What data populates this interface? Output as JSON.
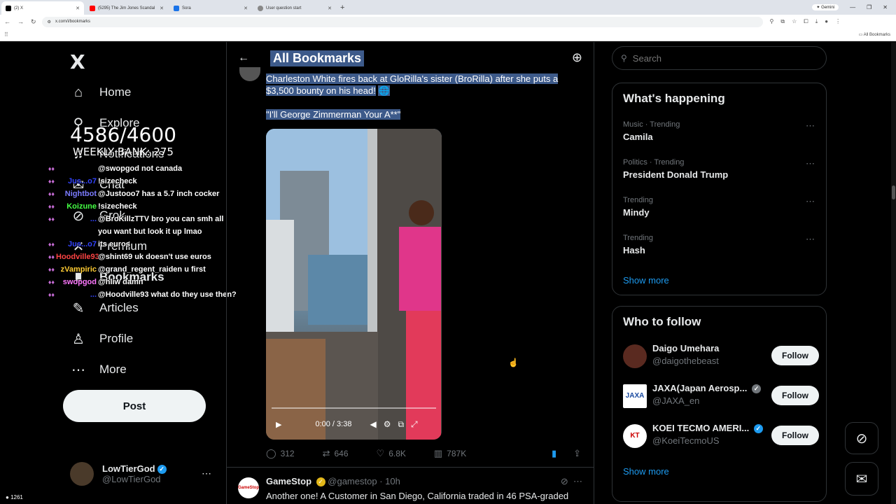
{
  "browser": {
    "tabs": [
      {
        "label": "(2) X",
        "color": "#000000"
      },
      {
        "label": "(5295) The Jim Jones Scandal",
        "color": "#ff0000"
      },
      {
        "label": "Sora",
        "color": "#1a73e8"
      },
      {
        "label": "User question start",
        "color": "#777777"
      }
    ],
    "gemini": "Gemini",
    "url": "x.com/i/bookmarks",
    "all_bookmarks": "All Bookmarks"
  },
  "sidebar": {
    "logo": "X",
    "items": [
      {
        "label": "Home",
        "icon": "home-icon"
      },
      {
        "label": "Explore",
        "icon": "search-icon"
      },
      {
        "label": "Notifications",
        "icon": "bell-icon"
      },
      {
        "label": "Chat",
        "icon": "mail-icon"
      },
      {
        "label": "Grok",
        "icon": "grok-icon"
      },
      {
        "label": "Premium",
        "icon": "x-icon"
      },
      {
        "label": "Bookmarks",
        "icon": "bookmark-icon"
      },
      {
        "label": "Articles",
        "icon": "article-icon"
      },
      {
        "label": "Profile",
        "icon": "person-icon"
      },
      {
        "label": "More",
        "icon": "more-icon"
      }
    ],
    "post": "Post",
    "user": {
      "name": "LowTierGod",
      "handle": "@LowTierGod"
    }
  },
  "overlay": {
    "count": "4586/4600",
    "weekly": "WEEKLY BANK: 275",
    "chat": [
      {
        "user": "",
        "msg": "@swopgod not canada",
        "color": "#c86dd7"
      },
      {
        "user": "Jus...o7",
        "msg": "!sizecheck",
        "color": "#3344ff"
      },
      {
        "user": "Nightbot",
        "msg": "@Justooo7 has a 5.7 inch cocker",
        "color": "#7c7cff"
      },
      {
        "user": "Koizune",
        "msg": "!sizecheck",
        "color": "#44ff44"
      },
      {
        "user": "...",
        "msg": "@BroKillzTTV bro you can smh all you want but look it up lmao",
        "color": "#3344ff"
      },
      {
        "user": "Jus...o7",
        "msg": "its euros",
        "color": "#3344ff"
      },
      {
        "user": "Hoodville93",
        "msg": "@shint69 uk doesn't use euros",
        "color": "#ff4444"
      },
      {
        "user": "zVampiric",
        "msg": "@grand_regent_raiden u first",
        "color": "#ffcc33"
      },
      {
        "user": "swopgod",
        "msg": "@hliw damn",
        "color": "#ff77ff"
      },
      {
        "user": "...",
        "msg": "@Hoodville93 what do they use then?",
        "color": "#3344ff"
      }
    ],
    "viewers": "1261"
  },
  "main": {
    "title": "All Bookmarks",
    "tweet": {
      "text1": "Charleston White fires back at GloRilla's sister (BroRilla) after she puts a $3,500 bounty on his head!",
      "text2": "\"I'll George Zimmerman Your A**\"",
      "video_time": "0:00 / 3:38",
      "progress": 0,
      "replies": "312",
      "reposts": "646",
      "likes": "6.8K",
      "views": "787K"
    },
    "tweet2": {
      "name": "GameStop",
      "handle": "@gamestop",
      "time": "· 10h",
      "text": "Another one! A Customer in San Diego, California traded in 46 PSA-graded",
      "avatar_text": "GameStop"
    }
  },
  "right": {
    "search_placeholder": "Search",
    "happening_title": "What's happening",
    "trends": [
      {
        "meta": "Music · Trending",
        "name": "Camila"
      },
      {
        "meta": "Politics · Trending",
        "name": "President Donald Trump"
      },
      {
        "meta": "Trending",
        "name": "Mindy"
      },
      {
        "meta": "Trending",
        "name": "Hash"
      }
    ],
    "show_more": "Show more",
    "follow_title": "Who to follow",
    "follows": [
      {
        "name": "Daigo Umehara",
        "handle": "@daigothebeast",
        "verified": false,
        "avatar_color": "#5a2a20"
      },
      {
        "name": "JAXA(Japan Aerosp...",
        "handle": "@JAXA_en",
        "verified": true,
        "avatar_color": "#ffffff"
      },
      {
        "name": "KOEI TECMO AMERI...",
        "handle": "@KoeiTecmoUS",
        "verified": true,
        "avatar_color": "#ffffff"
      }
    ],
    "follow_label": "Follow",
    "show_more2": "Show more"
  }
}
